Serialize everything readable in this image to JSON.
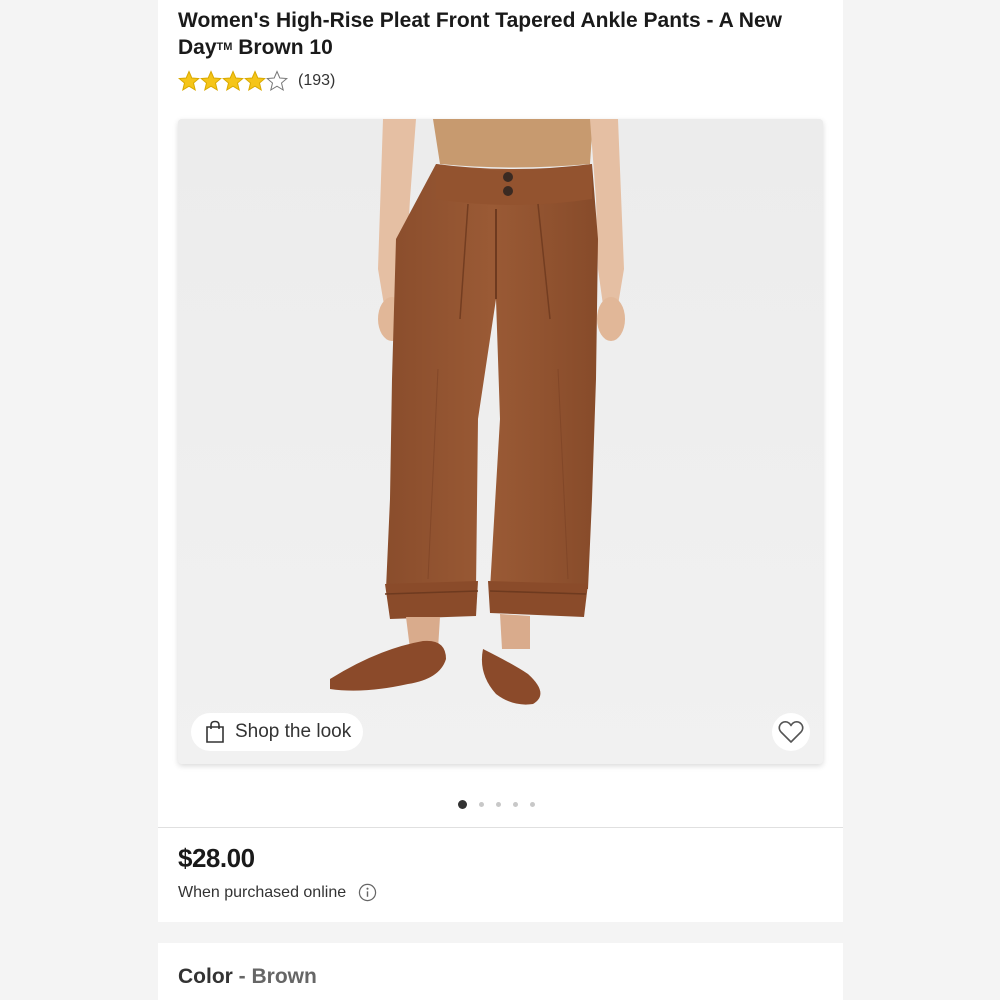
{
  "product": {
    "title": "Women's High-Rise Pleat Front Tapered Ankle Pants - A New Day",
    "trademark": "TM",
    "title_suffix": " Brown 10",
    "rating": 4,
    "rating_max": 5,
    "review_count": "(193)",
    "star_color": "#f5c518"
  },
  "gallery": {
    "shop_the_look": "Shop the look",
    "image_count": 5,
    "active_index": 0,
    "icons": {
      "bag": "shopping-bag-icon",
      "favorite": "heart-icon"
    }
  },
  "pricing": {
    "price": "$28.00",
    "note": "When purchased online",
    "note_icon": "info-icon"
  },
  "variant": {
    "color_label": "Color",
    "separator": " - ",
    "color_value": "Brown"
  }
}
